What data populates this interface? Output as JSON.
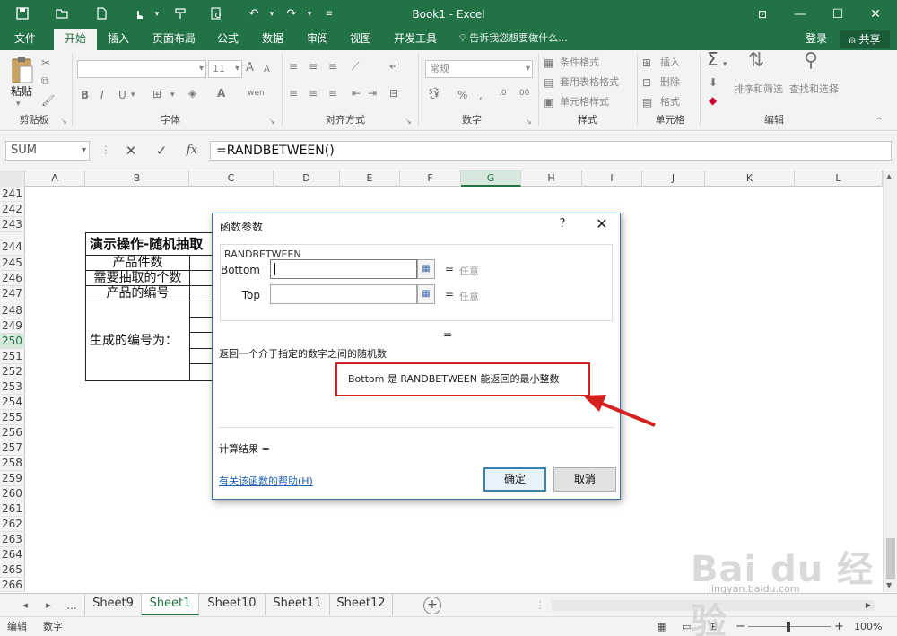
{
  "window": {
    "title": "Book1 - Excel",
    "icons": [
      "save-icon",
      "open-icon",
      "new-icon",
      "touch-mode-icon",
      "format-painter-icon",
      "print-preview-icon",
      "undo-icon",
      "redo-icon",
      "customize-qat-icon"
    ],
    "controls": {
      "ribbon_options": "ribbon-display-options-icon",
      "minimize": "—",
      "maximize": "☐",
      "close": "✕"
    }
  },
  "menu": {
    "items": [
      "文件",
      "开始",
      "插入",
      "页面布局",
      "公式",
      "数据",
      "审阅",
      "视图",
      "开发工具"
    ],
    "active": "开始",
    "tell_me": "告诉我您想要做什么...",
    "login": "登录",
    "share": "共享"
  },
  "ribbon": {
    "clipboard": {
      "label": "剪贴板",
      "paste": "粘贴"
    },
    "font": {
      "label": "字体",
      "font_size": "11",
      "bold": "B",
      "italic": "I",
      "underline": "U",
      "grow": "A",
      "shrink": "A",
      "phonetic": "wén"
    },
    "alignment": {
      "label": "对齐方式"
    },
    "number": {
      "label": "数字",
      "format": "常规",
      "percent": "%",
      "comma": ","
    },
    "styles": {
      "label": "样式",
      "conditional": "条件格式",
      "table": "套用表格格式",
      "cell": "单元格样式"
    },
    "cells": {
      "label": "单元格",
      "insert": "插入",
      "delete": "删除",
      "format": "格式"
    },
    "editing": {
      "label": "编辑",
      "sort_filter": "排序和筛选",
      "find_select": "查找和选择"
    }
  },
  "formula_bar": {
    "name_box": "SUM",
    "cancel": "✕",
    "enter": "✓",
    "fx": "fx",
    "formula": "=RANDBETWEEN()"
  },
  "columns": [
    "A",
    "B",
    "C",
    "D",
    "E",
    "F",
    "G",
    "H",
    "I",
    "J",
    "K",
    "L"
  ],
  "selected_column": "G",
  "rows": [
    "241",
    "242",
    "243",
    "244",
    "245",
    "246",
    "247",
    "248",
    "249",
    "250",
    "251",
    "252",
    "253",
    "254",
    "255",
    "256",
    "257",
    "258",
    "259",
    "260",
    "261",
    "262",
    "263",
    "264",
    "265",
    "266"
  ],
  "selected_row": "250",
  "sheet": {
    "title_cell": "演示操作-随机抽取",
    "label_count": "产品件数",
    "label_extract": "需要抽取的个数",
    "label_ids": "产品的编号",
    "label_result": "生成的编号为："
  },
  "tabs": {
    "nav_prev": "◂",
    "nav_next": "▸",
    "more": "...",
    "sheets": [
      "Sheet9",
      "Sheet1",
      "Sheet10",
      "Sheet11",
      "Sheet12"
    ],
    "active": "Sheet1",
    "add": "+"
  },
  "status": {
    "mode": "编辑",
    "numlock": "数字",
    "zoom_out": "−",
    "zoom_in": "+",
    "zoom": "100%"
  },
  "dialog": {
    "title": "函数参数",
    "help": "?",
    "close": "✕",
    "function_name": "RANDBETWEEN",
    "args": [
      {
        "label": "Bottom",
        "value": "",
        "eq": "=",
        "result": "任意"
      },
      {
        "label": "Top",
        "value": "",
        "eq": "=",
        "result": "任意"
      }
    ],
    "formula_result_eq": "=",
    "description": "返回一个介于指定的数字之间的随机数",
    "arg_description": "Bottom  是 RANDBETWEEN 能返回的最小整数",
    "calc_result": "计算结果 =",
    "help_link": "有关该函数的帮助(H)",
    "ok": "确定",
    "cancel": "取消"
  },
  "annotation": {
    "color": "#d62020"
  },
  "watermark": {
    "logo": "Bai du 经验",
    "url": "jingyan.baidu.com"
  },
  "colors": {
    "brand": "#217346",
    "ribbon_bg": "#f3f3f3",
    "link": "#1a5fb4"
  }
}
